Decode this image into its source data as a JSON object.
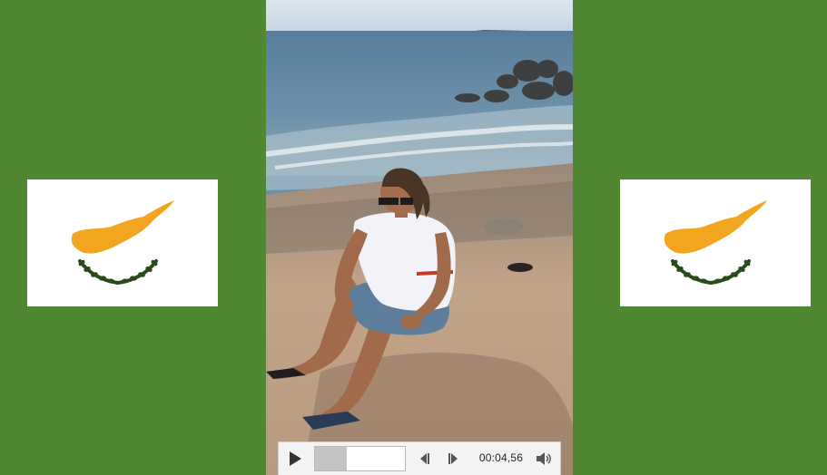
{
  "page": {
    "background_color": "#4f8733",
    "flag_icon": "cyprus-flag-icon"
  },
  "player": {
    "time_display": "00:04,56",
    "progress_fraction": 0.35,
    "play_icon": "play-icon",
    "previous_frame_icon": "step-back-icon",
    "next_frame_icon": "step-forward-icon",
    "volume_icon": "volume-icon"
  }
}
